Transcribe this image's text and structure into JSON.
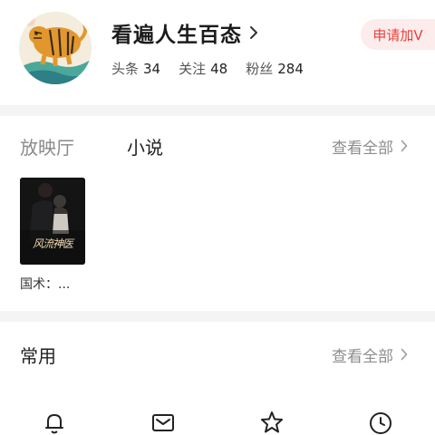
{
  "profile": {
    "name": "看遍人生百态",
    "stats": [
      {
        "label": "头条",
        "value": "34"
      },
      {
        "label": "关注",
        "value": "48"
      },
      {
        "label": "粉丝",
        "value": "284"
      }
    ],
    "apply_v_label": "申请加V"
  },
  "media_section": {
    "tabs": [
      {
        "label": "放映厅",
        "active": false
      },
      {
        "label": "小说",
        "active": true
      }
    ],
    "view_all_label": "查看全部",
    "items": [
      {
        "title": "国术：...",
        "cover_title": "风流神医"
      }
    ]
  },
  "common_section": {
    "title": "常用",
    "view_all_label": "查看全部"
  },
  "bottom_icons": [
    "bell-icon",
    "mail-icon",
    "star-icon",
    "clock-icon"
  ],
  "colors": {
    "accent_red": "#e9403d",
    "apply_bg": "#fdecec",
    "divider": "#f4f4f4",
    "muted_text": "#8d8d8d"
  }
}
